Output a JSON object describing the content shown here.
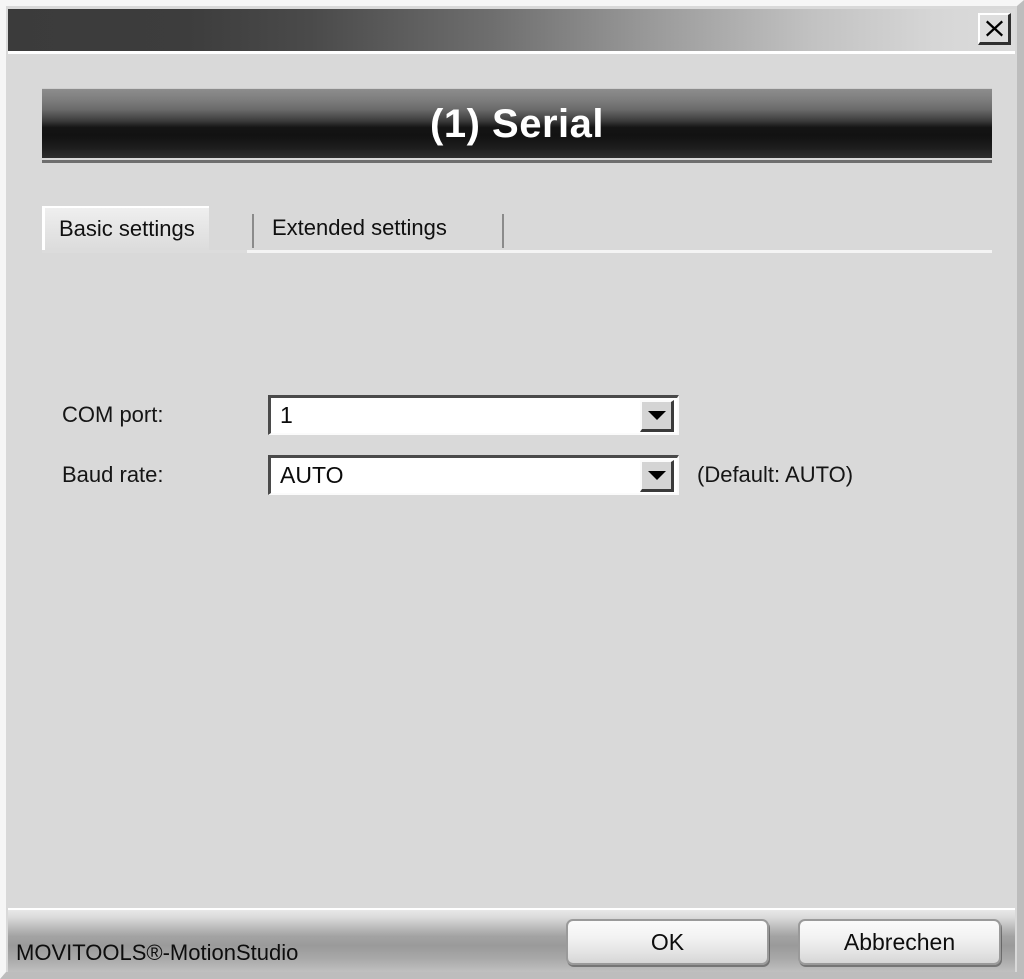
{
  "window": {
    "close_icon": "close-x-icon",
    "banner_title": "(1) Serial"
  },
  "tabs": [
    {
      "label": "Basic settings",
      "active": true
    },
    {
      "label": "Extended settings",
      "active": false
    }
  ],
  "form": {
    "fields": [
      {
        "label": "COM port:",
        "value": "1",
        "hint": "",
        "dropdown_icon": "chevron-down-icon"
      },
      {
        "label": "Baud rate:",
        "value": "AUTO",
        "hint": "(Default: AUTO)",
        "dropdown_icon": "chevron-down-icon"
      }
    ]
  },
  "footer": {
    "brand": "MOVITOOLS®-MotionStudio",
    "ok_label": "OK",
    "cancel_label": "Abbrechen"
  },
  "colors": {
    "dialog_face": "#d9d9d9",
    "banner_dark": "#121212",
    "banner_light": "#8d8d8d",
    "titlebar_dark": "#3b3b3b",
    "titlebar_light": "#dcdcdc",
    "text": "#101010",
    "banner_text": "#ffffff",
    "field_background": "#ffffff"
  }
}
